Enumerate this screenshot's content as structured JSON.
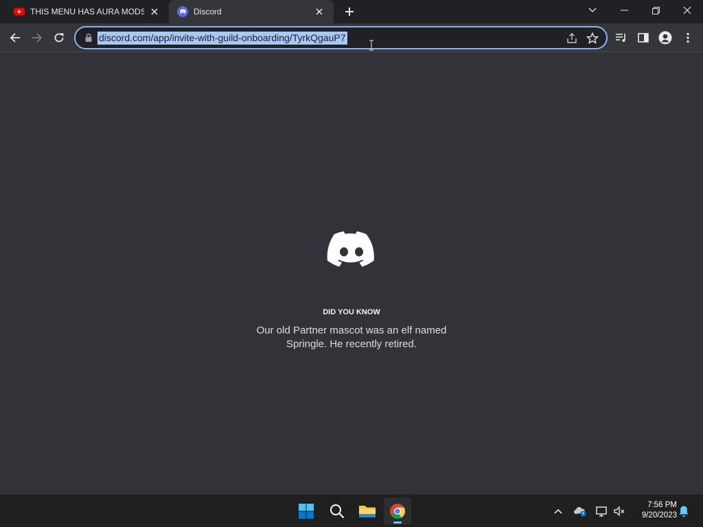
{
  "tabs": [
    {
      "title": "THIS MENU HAS AURA MODS???",
      "favicon": "youtube-icon",
      "active": false
    },
    {
      "title": "Discord",
      "favicon": "discord-icon",
      "active": true
    }
  ],
  "address_bar": {
    "url": "discord.com/app/invite-with-guild-onboarding/TyrkQgauP7"
  },
  "loading_screen": {
    "tip_heading": "DID YOU KNOW",
    "tip_text": "Our old Partner mascot was an elf named Springle. He recently retired."
  },
  "taskbar": {
    "time": "7:56 PM",
    "date": "9/20/2023"
  },
  "colors": {
    "discord_background": "#313338",
    "discord_blurple": "#5865f2",
    "youtube_red": "#ff0000",
    "omnibox_focus": "#8ab4f8",
    "taskbar_accent": "#60cdff"
  }
}
